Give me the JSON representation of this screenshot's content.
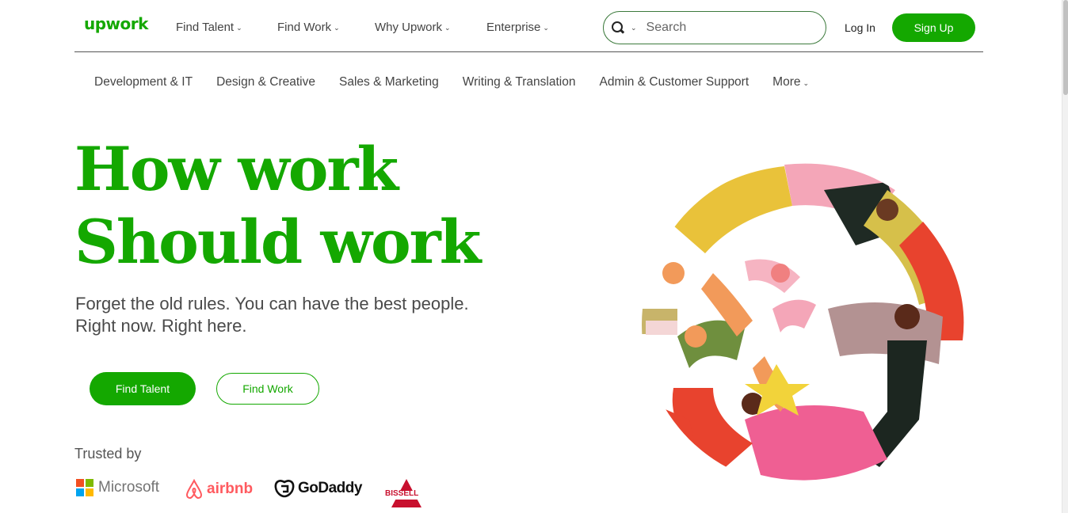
{
  "header": {
    "logo": "upwork",
    "nav": [
      {
        "label": "Find Talent"
      },
      {
        "label": "Find Work"
      },
      {
        "label": "Why Upwork"
      },
      {
        "label": "Enterprise"
      }
    ],
    "search_placeholder": "Search",
    "login": "Log In",
    "signup": "Sign Up"
  },
  "subnav": {
    "items": [
      "Development & IT",
      "Design & Creative",
      "Sales & Marketing",
      "Writing & Translation",
      "Admin & Customer Support",
      "More"
    ]
  },
  "hero": {
    "title_line1": "How work",
    "title_line2": "Should work",
    "subtitle_line1": "Forget the old rules. You can have the best people.",
    "subtitle_line2": "Right now. Right here.",
    "find_talent": "Find Talent",
    "find_work": "Find Work"
  },
  "trusted": {
    "label": "Trusted by",
    "brands": [
      "Microsoft",
      "airbnb",
      "GoDaddy",
      "BISSELL"
    ]
  },
  "colors": {
    "brand_green": "#14a800",
    "illustration_red": "#e8432e",
    "illustration_pink": "#f4a6b8",
    "illustration_yellow": "#e9c23a"
  }
}
